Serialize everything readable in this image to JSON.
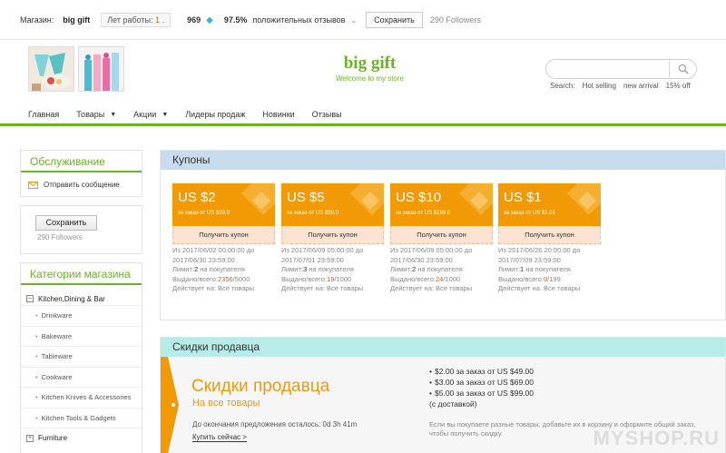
{
  "topbar": {
    "store_label": "Магазин:",
    "store_name": "big gift",
    "years_label": "Лет работы:",
    "years_value": "1",
    "score": "969",
    "positive_pct": "97.5%",
    "positive_label": "положительных отзывов",
    "save_label": "Сохранить",
    "followers": "290 Followers"
  },
  "header": {
    "brand_name": "big gift",
    "tagline": "Welcome to my store",
    "search_placeholder": "",
    "search_label": "Search:",
    "search_links": [
      "Hot selling",
      "new arrival",
      "15% off"
    ]
  },
  "nav": {
    "items": [
      "Главная",
      "Товары",
      "Акции",
      "Лидеры продаж",
      "Новинки",
      "Отзывы"
    ]
  },
  "sidebar": {
    "service_title": "Обслуживание",
    "message_label": "Отправить сообщение",
    "save_label": "Сохранить",
    "followers": "290 Followers",
    "categories_title": "Категории магазина",
    "category_main": "Kitchen,Dining & Bar",
    "subcategories": [
      "Drinkware",
      "Bakeware",
      "Tableware",
      "Cookware",
      "Kitchen Knives & Accessories",
      "Kitchen Tools & Gadgets"
    ],
    "category_second": "Furniture"
  },
  "coupons": {
    "title": "Купоны",
    "get_label": "Получить купон",
    "limit_label": "Лимит:",
    "per_buyer": "на покупателя",
    "issued_label": "Выдано/всего:",
    "valid_label": "Действует на: Все товары",
    "items": [
      {
        "amount": "US $2",
        "condition": "за заказ от US $29.0",
        "from": "Из 2017/06/02 00:00:00 до",
        "to": "2017/06/30 23:59:00",
        "limit": "2",
        "issued": "2356",
        "total": "/5000"
      },
      {
        "amount": "US $5",
        "condition": "за заказ от US $99.0",
        "from": "Из 2017/06/09 05:00:00 до",
        "to": "2017/07/01 23:59:00",
        "limit": "3",
        "issued": "19",
        "total": "/1000"
      },
      {
        "amount": "US $10",
        "condition": "за заказ от US $199.0",
        "from": "Из 2017/06/09 05:00:00 до",
        "to": "2017/06/30 23:59:00",
        "limit": "2",
        "issued": "24",
        "total": "/1000"
      },
      {
        "amount": "US $1",
        "condition": "за заказ от US $1.01",
        "from": "Из 2017/06/26 20:00:00 до",
        "to": "2017/07/09 23:59:00",
        "limit": "1",
        "issued": "0",
        "total": "/199"
      }
    ]
  },
  "discounts": {
    "title": "Скидки продавца",
    "big_title": "Скидки продавца",
    "all_goods": "На все товары",
    "until": "До окончания предложения осталось: 0d 3h 41m",
    "buy_now": "Купить сейчас >",
    "tiers": [
      "$2.00 за заказ от US $49.00",
      "$3.00 за заказ от US $69.00",
      "$5.00 за заказ от US $99.00"
    ],
    "delivery": "(с доставкой)",
    "note": "Если вы покупаете разные товары, добавьте их в корзину и оформите общий заказ, чтобы получить скидку."
  },
  "watermark": "MYSHOP.RU",
  "colors": {
    "accent": "#6cb226",
    "coupon": "#f29a06",
    "coupon_head": "#c9dcee",
    "discount_head": "#b8ece9"
  }
}
